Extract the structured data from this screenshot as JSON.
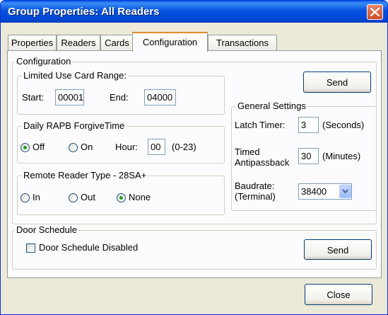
{
  "window": {
    "title": "Group Properties: All Readers"
  },
  "tabs": [
    {
      "label": "Properties"
    },
    {
      "label": "Readers"
    },
    {
      "label": "Cards"
    },
    {
      "label": "Configuration",
      "active": true
    },
    {
      "label": "Transactions"
    }
  ],
  "configuration": {
    "label": "Configuration",
    "card_range": {
      "label": "Limited Use Card Range:",
      "start_label": "Start:",
      "start_value": "00001",
      "end_label": "End:",
      "end_value": "04000"
    },
    "rapb": {
      "label": "Daily RAPB ForgiveTime",
      "off_label": "Off",
      "on_label": "On",
      "selected": "Off",
      "hour_label": "Hour:",
      "hour_value": "00",
      "hour_range": "(0-23)"
    },
    "reader_type": {
      "label": "Remote Reader Type - 28SA+",
      "in_label": "In",
      "out_label": "Out",
      "none_label": "None",
      "selected": "None"
    },
    "send_label": "Send",
    "general": {
      "label": "General Settings",
      "latch_label": "Latch Timer:",
      "latch_value": "3",
      "latch_unit": "(Seconds)",
      "timed_label_1": "Timed",
      "timed_label_2": "Antipassback",
      "timed_value": "30",
      "timed_unit": "(Minutes)",
      "baud_label_1": "Baudrate:",
      "baud_label_2": "(Terminal)",
      "baud_value": "38400"
    }
  },
  "door_schedule": {
    "label": "Door Schedule",
    "checkbox_label": "Door Schedule Disabled",
    "checked": false,
    "send_label": "Send"
  },
  "footer": {
    "close_label": "Close"
  },
  "colors": {
    "title_bar": "#0553e0",
    "close_button": "#d04a25",
    "dialog_face": "#ece9d8",
    "radio_selected": "#21a121"
  }
}
